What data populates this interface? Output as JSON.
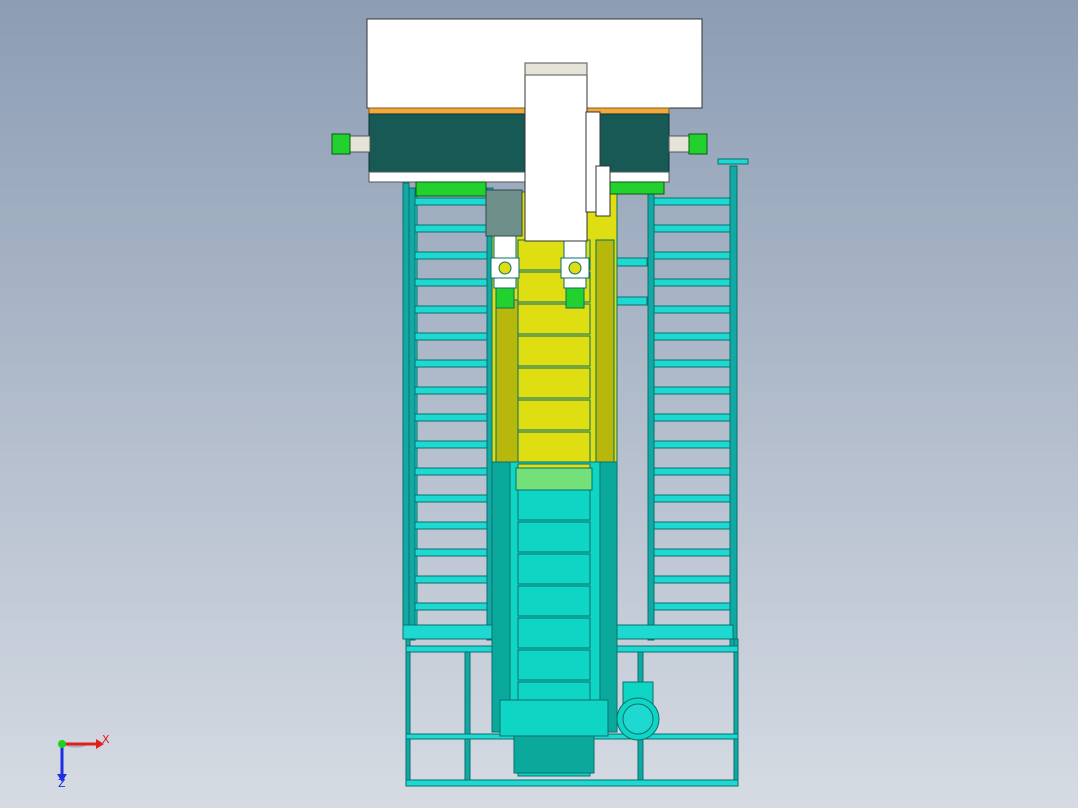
{
  "viewport": {
    "background_top": "#8c9db4",
    "background_bottom": "#d6dbe3"
  },
  "model": {
    "colors": {
      "frame": "#1ed9d2",
      "frame_dark": "#12a8a4",
      "frame_edge": "#0b6f6c",
      "yellow": "#dede12",
      "yellow_dark": "#b7b70c",
      "cyan_body": "#0fd5c4",
      "cyan_dark": "#0ba99c",
      "green": "#22d12e",
      "light_green": "#74e07a",
      "dark_teal": "#175955",
      "white": "#ffffff",
      "orange": "#f2a93b",
      "gray": "#6f8f8a",
      "tan": "#e6e4d8"
    }
  },
  "triad": {
    "x_label": "X",
    "z_label": "Z",
    "x_color": "#e21d1d",
    "y_color": "#1dd11d",
    "z_color": "#1d2fe2"
  }
}
